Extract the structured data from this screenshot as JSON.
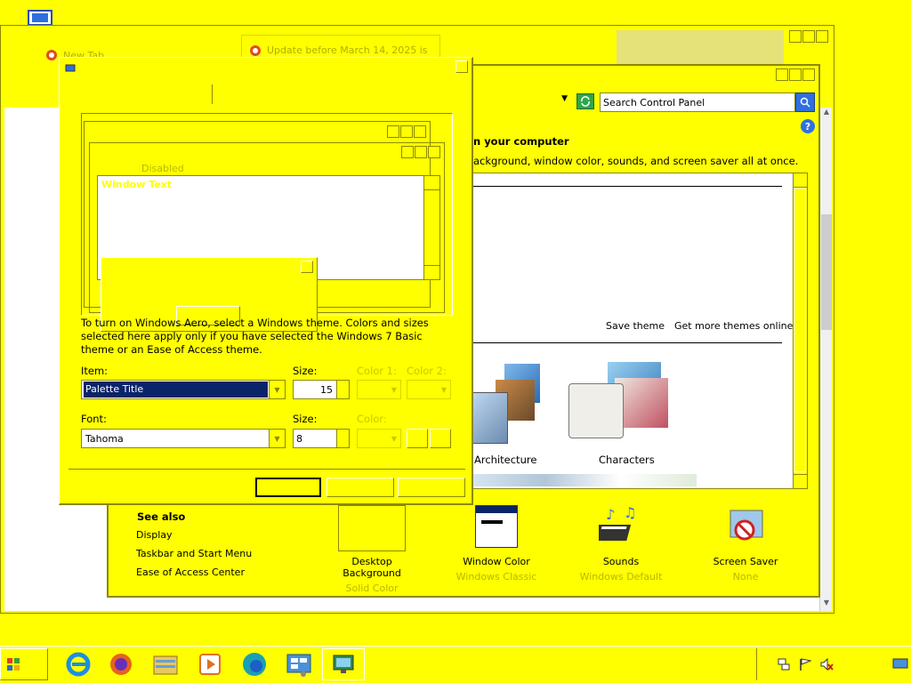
{
  "browser": {
    "tabs": [
      {
        "label": "New Tab"
      },
      {
        "label": "Update before March 14, 2025 is"
      }
    ]
  },
  "control_panel": {
    "search_placeholder": "Search Control Panel",
    "heading": "n your computer",
    "subheading": "ackground, window color, sounds, and screen saver all at once.",
    "save_theme": "Save theme",
    "get_more": "Get more themes online",
    "themes": [
      {
        "label": "Architecture"
      },
      {
        "label": "Characters"
      }
    ],
    "see_also": {
      "title": "See also",
      "links": [
        "Display",
        "Taskbar and Start Menu",
        "Ease of Access Center"
      ]
    },
    "bottom_items": [
      {
        "label": "Desktop Background",
        "sub": "Solid Color"
      },
      {
        "label": "Window Color",
        "sub": "Windows Classic"
      },
      {
        "label": "Sounds",
        "sub": "Windows Default"
      },
      {
        "label": "Screen Saver",
        "sub": "None"
      }
    ]
  },
  "dialog": {
    "preview": {
      "disabled": "Disabled",
      "window_text": "Window Text"
    },
    "info": "To turn on Windows Aero, select a Windows theme.  Colors and sizes selected here apply only if you have selected the Windows 7 Basic theme or an Ease of Access theme.",
    "item_label": "Item:",
    "item_value": "Palette Title",
    "size_label": "Size:",
    "size_value": "15",
    "color1_label": "Color 1:",
    "color2_label": "Color 2:",
    "font_label": "Font:",
    "font_value": "Tahoma",
    "font_size_label": "Size:",
    "font_size_value": "8",
    "color_label": "Color:"
  },
  "colors": {
    "background": "#ffff00",
    "selection": "#0a246a",
    "shadow": "#8a8a00"
  }
}
